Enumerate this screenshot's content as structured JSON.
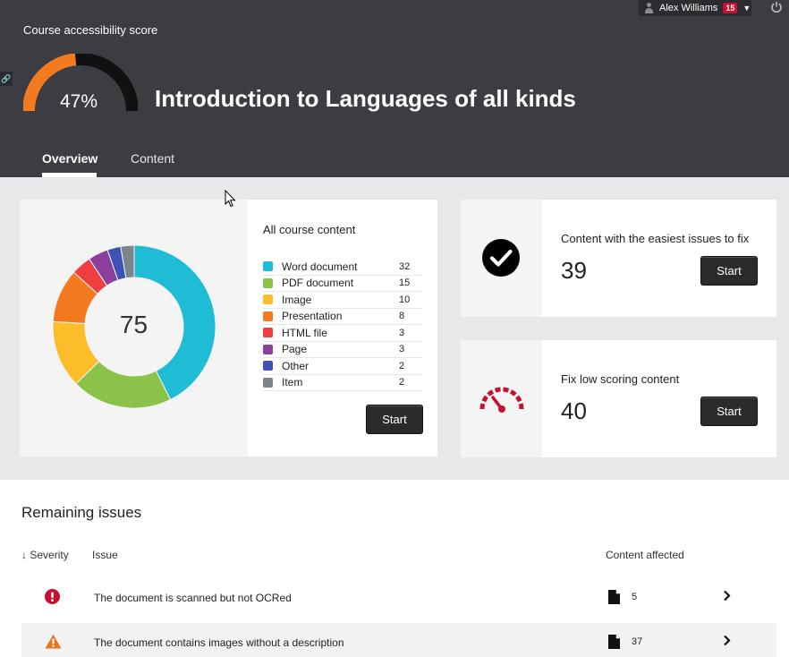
{
  "header": {
    "user_name": "Alex Williams",
    "notification_count": "15",
    "score_label": "Course accessibility score",
    "score_value": 47,
    "score_text": "47%",
    "course_title": "Introduction to Languages of all kinds",
    "tabs": [
      {
        "label": "Overview",
        "active": true
      },
      {
        "label": "Content",
        "active": false
      }
    ]
  },
  "all_content": {
    "title": "All course content",
    "total": "75",
    "start_label": "Start",
    "items": [
      {
        "label": "Word document",
        "count": "32",
        "color": "#1fbcd6"
      },
      {
        "label": "PDF document",
        "count": "15",
        "color": "#8bc34a"
      },
      {
        "label": "Image",
        "count": "10",
        "color": "#fbbd2a"
      },
      {
        "label": "Presentation",
        "count": "8",
        "color": "#f47a20"
      },
      {
        "label": "HTML file",
        "count": "3",
        "color": "#ef3e42"
      },
      {
        "label": "Page",
        "count": "3",
        "color": "#8d3f9e"
      },
      {
        "label": "Other",
        "count": "2",
        "color": "#3f51b5"
      },
      {
        "label": "Item",
        "count": "2",
        "color": "#7b868c"
      }
    ]
  },
  "easy_issues": {
    "heading": "Content with the easiest issues to fix",
    "count": "39",
    "start_label": "Start"
  },
  "low_scoring": {
    "heading": "Fix low scoring content",
    "count": "40",
    "start_label": "Start"
  },
  "issues": {
    "title": "Remaining issues",
    "columns": {
      "severity": "Severity",
      "issue": "Issue",
      "affected": "Content affected"
    },
    "rows": [
      {
        "severity": "severe",
        "text": "The document is scanned but not OCRed",
        "affected": "5"
      },
      {
        "severity": "major",
        "text": "The document contains images without a description",
        "affected": "37"
      }
    ]
  },
  "colors": {
    "header_bg": "#3c3d42",
    "gauge_fill": "#f47a20",
    "severe": "#c8102e",
    "major": "#e87722"
  }
}
